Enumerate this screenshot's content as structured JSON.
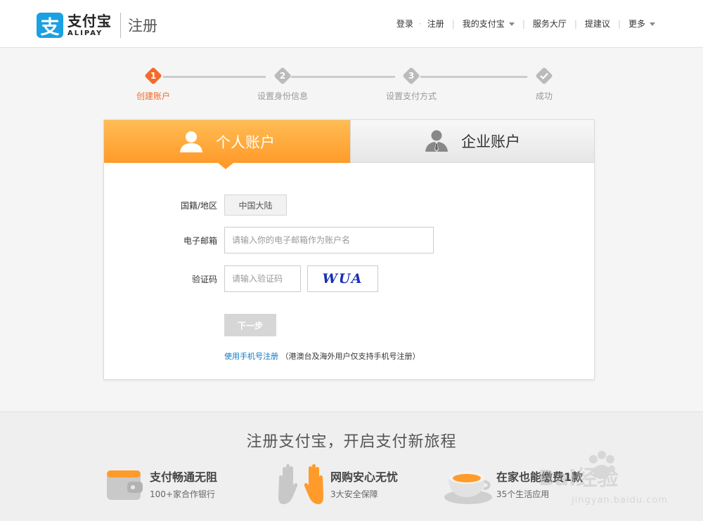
{
  "header": {
    "logo_glyph": "支",
    "logo_cn": "支付宝",
    "logo_en": "ALIPAY",
    "page_title": "注册",
    "nav": {
      "login": "登录",
      "register": "注册",
      "my_alipay": "我的支付宝",
      "service_hall": "服务大厅",
      "feedback": "提建议",
      "more": "更多"
    }
  },
  "steps": [
    {
      "num": "1",
      "label": "创建账户",
      "active": true
    },
    {
      "num": "2",
      "label": "设置身份信息",
      "active": false
    },
    {
      "num": "3",
      "label": "设置支付方式",
      "active": false
    },
    {
      "num": "",
      "label": "成功",
      "active": false
    }
  ],
  "tabs": {
    "personal": "个人账户",
    "business": "企业账户"
  },
  "form": {
    "country_label": "国籍/地区",
    "country_value": "中国大陆",
    "email_label": "电子邮箱",
    "email_placeholder": "请输入你的电子邮箱作为账户名",
    "code_label": "验证码",
    "code_placeholder": "请输入验证码",
    "captcha_text": "WUA",
    "next_button": "下一步",
    "phone_link": "使用手机号注册",
    "phone_note": "（港澳台及海外用户仅支持手机号注册）"
  },
  "promo": {
    "title": "注册支付宝，开启支付新旅程",
    "features": [
      {
        "title": "支付畅通无阻",
        "sub": "100+家合作银行"
      },
      {
        "title": "网购安心无忧",
        "sub": "3大安全保障"
      },
      {
        "title": "在家也能缴费1款",
        "sub": "35个生活应用"
      }
    ]
  },
  "watermark": {
    "brand": "Bai经验",
    "url": "jingyan.baidu.com"
  },
  "colors": {
    "accent": "#f26b2b",
    "tab_orange": "#ff9b2a",
    "link_blue": "#0e79c4",
    "logo_blue": "#1ba0e1"
  }
}
